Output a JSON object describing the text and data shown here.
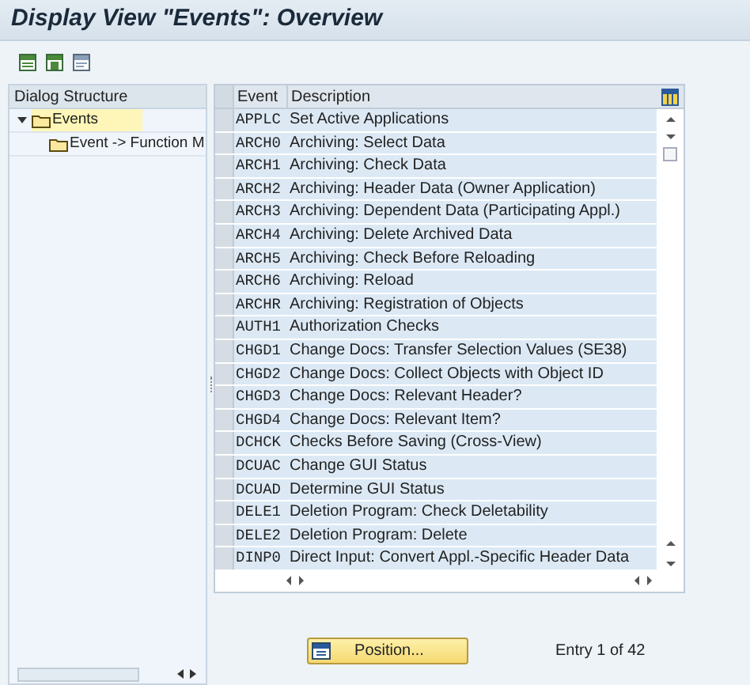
{
  "window": {
    "title": "Display View \"Events\": Overview"
  },
  "dialog_structure": {
    "title": "Dialog Structure",
    "tree": [
      {
        "label": "Events",
        "selected": true,
        "expanded": true,
        "children": [
          {
            "label": "Event -> Function M",
            "selected": false
          }
        ]
      }
    ]
  },
  "table": {
    "columns": [
      "Event",
      "Description"
    ],
    "rows": [
      {
        "event": "APPLC",
        "description": "Set Active Applications"
      },
      {
        "event": "ARCH0",
        "description": "Archiving: Select Data"
      },
      {
        "event": "ARCH1",
        "description": "Archiving: Check Data"
      },
      {
        "event": "ARCH2",
        "description": "Archiving: Header Data (Owner Application)"
      },
      {
        "event": "ARCH3",
        "description": "Archiving: Dependent Data (Participating Appl.)"
      },
      {
        "event": "ARCH4",
        "description": "Archiving: Delete Archived Data"
      },
      {
        "event": "ARCH5",
        "description": "Archiving: Check Before Reloading"
      },
      {
        "event": "ARCH6",
        "description": "Archiving: Reload"
      },
      {
        "event": "ARCHR",
        "description": "Archiving: Registration of Objects"
      },
      {
        "event": "AUTH1",
        "description": "Authorization Checks"
      },
      {
        "event": "CHGD1",
        "description": "Change Docs: Transfer Selection Values (SE38)"
      },
      {
        "event": "CHGD2",
        "description": "Change Docs: Collect Objects with Object ID"
      },
      {
        "event": "CHGD3",
        "description": "Change Docs: Relevant Header?"
      },
      {
        "event": "CHGD4",
        "description": "Change Docs: Relevant Item?"
      },
      {
        "event": "DCHCK",
        "description": "Checks Before Saving (Cross-View)"
      },
      {
        "event": "DCUAC",
        "description": "Change GUI Status"
      },
      {
        "event": "DCUAD",
        "description": "Determine GUI Status"
      },
      {
        "event": "DELE1",
        "description": "Deletion Program: Check Deletability"
      },
      {
        "event": "DELE2",
        "description": "Deletion Program: Delete"
      },
      {
        "event": "DINP0",
        "description": "Direct Input: Convert Appl.-Specific Header Data"
      }
    ]
  },
  "position_button": {
    "label": "Position..."
  },
  "entry_info": "Entry 1 of 42"
}
